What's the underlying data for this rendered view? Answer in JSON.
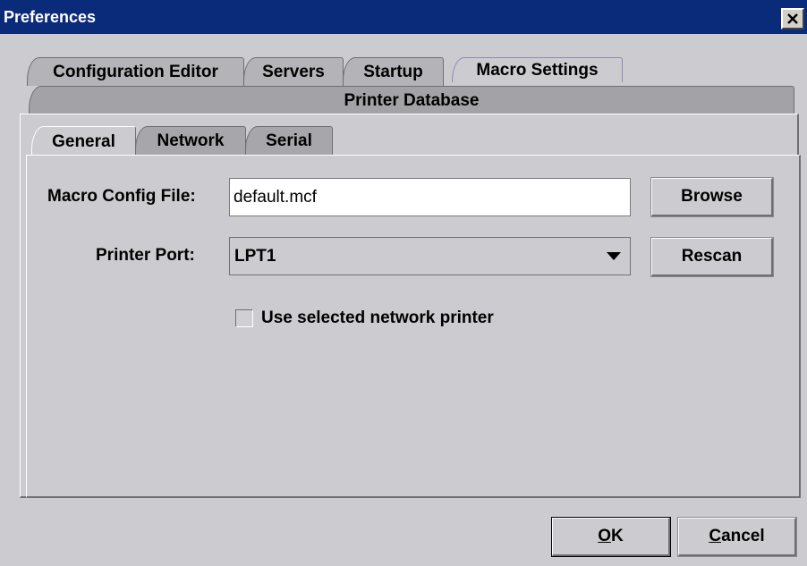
{
  "window": {
    "title": "Preferences",
    "title_bar_color": "#0a2a7a",
    "close_icon": "close-icon"
  },
  "top_tabs": {
    "row1": [
      "Configuration Editor",
      "Servers",
      "Startup",
      "Macro Settings"
    ],
    "row2": [
      "Printer Database"
    ],
    "selected": "Macro Settings"
  },
  "inner_tabs": {
    "items": [
      "General",
      "Network",
      "Serial"
    ],
    "selected": "General"
  },
  "form": {
    "config_file_label": "Macro Config File:",
    "config_file_value": "default.mcf",
    "browse_label": "Browse",
    "printer_port_label": "Printer Port:",
    "printer_port_value": "LPT1",
    "rescan_label": "Rescan",
    "network_printer_label": "Use selected network printer",
    "network_printer_checked": false
  },
  "footer": {
    "ok_mnemonic": "O",
    "ok_rest": "K",
    "cancel_mnemonic": "C",
    "cancel_rest": "ancel"
  }
}
